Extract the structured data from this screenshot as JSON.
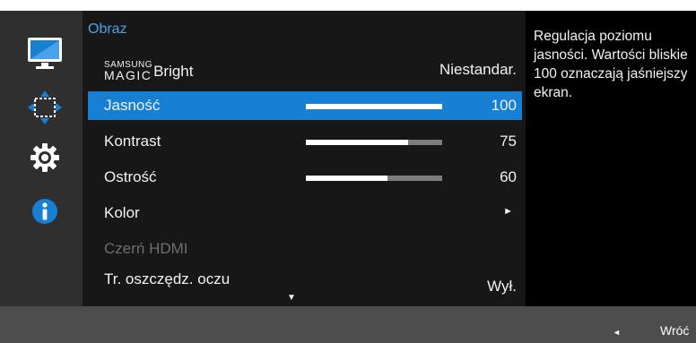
{
  "menu": {
    "title": "Obraz",
    "rows": [
      {
        "label_brand_top": "SAMSUNG",
        "label_brand_bottom": "MAGIC",
        "label": "Bright",
        "value": "Niestandar."
      },
      {
        "label": "Jasność",
        "value": "100",
        "level": 100
      },
      {
        "label": "Kontrast",
        "value": "75",
        "level": 75
      },
      {
        "label": "Ostrość",
        "value": "60",
        "level": 60
      },
      {
        "label": "Kolor",
        "arrow": "►"
      },
      {
        "label": "Czerń HDMI"
      },
      {
        "label": "Tr. oszczędz. oczu",
        "value": "Wył."
      }
    ],
    "scroll_indicator": "▼"
  },
  "help": {
    "text": "Regulacja poziomu jasności. Wartości bliskie 100 oznaczają jaśniejszy ekran."
  },
  "bottom": {
    "back_arrow": "◄",
    "back_label": "Wróć"
  },
  "icons": [
    "monitor-icon",
    "position-arrows-icon",
    "gear-icon",
    "info-icon"
  ],
  "colors": {
    "accent": "#1780d2",
    "title": "#4aa3e8",
    "panel": "#171717",
    "rail": "#2f2f2f",
    "help_bg": "#000000",
    "bottom_bar": "#4d4d4d"
  }
}
